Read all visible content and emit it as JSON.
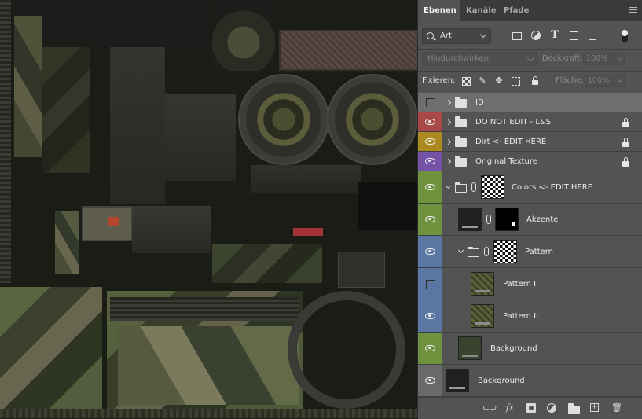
{
  "panel": {
    "tabs": [
      {
        "label": "Ebenen",
        "active": true
      },
      {
        "label": "Kanäle",
        "active": false
      },
      {
        "label": "Pfade",
        "active": false
      }
    ],
    "filter": {
      "kind_value": "Art"
    },
    "blend_mode": "Hindurchwirken",
    "opacity_label": "Deckkraft:",
    "opacity_value": "100%",
    "lock_label": "Fixieren:",
    "fill_label": "Fläche:",
    "fill_value": "100%"
  },
  "layers": [
    {
      "name": "ID",
      "type": "group",
      "visible": false,
      "color": "gray",
      "locked": false,
      "selected": true
    },
    {
      "name": "DO NOT EDIT  - L&S",
      "type": "group",
      "visible": true,
      "color": "red",
      "locked": true
    },
    {
      "name": "Dirt <- EDIT HERE",
      "type": "group",
      "visible": true,
      "color": "yellow",
      "locked": true
    },
    {
      "name": "Original Texture",
      "type": "group",
      "visible": true,
      "color": "violet",
      "locked": true
    },
    {
      "name": "Colors <- EDIT HERE",
      "type": "group-expanded",
      "visible": true,
      "color": "green",
      "locked": false
    },
    {
      "name": "Akzente",
      "type": "layer-mask",
      "visible": true,
      "color": "green",
      "locked": false
    },
    {
      "name": "Pattern",
      "type": "group-expanded",
      "visible": true,
      "color": "blue",
      "locked": false
    },
    {
      "name": "Pattern I",
      "type": "layer",
      "visible": false,
      "color": "blue",
      "locked": false
    },
    {
      "name": "Pattern II",
      "type": "layer",
      "visible": true,
      "color": "blue",
      "locked": false
    },
    {
      "name": "Background",
      "type": "layer",
      "visible": true,
      "color": "green",
      "locked": false
    },
    {
      "name": "Background",
      "type": "layer",
      "visible": true,
      "color": "gray",
      "locked": false
    }
  ],
  "icons": {
    "filter": [
      "image-filter-icon",
      "adjustment-filter-icon",
      "type-filter-icon",
      "shape-filter-icon",
      "smart-object-filter-icon"
    ],
    "lock": [
      "lock-pixels-icon",
      "lock-paint-icon",
      "lock-position-icon",
      "lock-artboard-icon",
      "lock-all-icon"
    ],
    "bottom": [
      "link-layers-icon",
      "layer-style-icon",
      "add-mask-icon",
      "adjustment-layer-icon",
      "new-group-icon",
      "new-layer-icon",
      "delete-layer-icon"
    ]
  },
  "bottom_labels": {
    "fx": "fx"
  },
  "colors": {
    "panel_bg": "#535353",
    "tab_bar": "#3a3a3a",
    "selected_row": "#6e6e6e",
    "label_red": "#a84848",
    "label_yellow": "#ad8a21",
    "label_violet": "#7452a8",
    "label_green": "#6f923f",
    "label_blue": "#5a76a3",
    "label_gray": "#6a6a6a"
  }
}
